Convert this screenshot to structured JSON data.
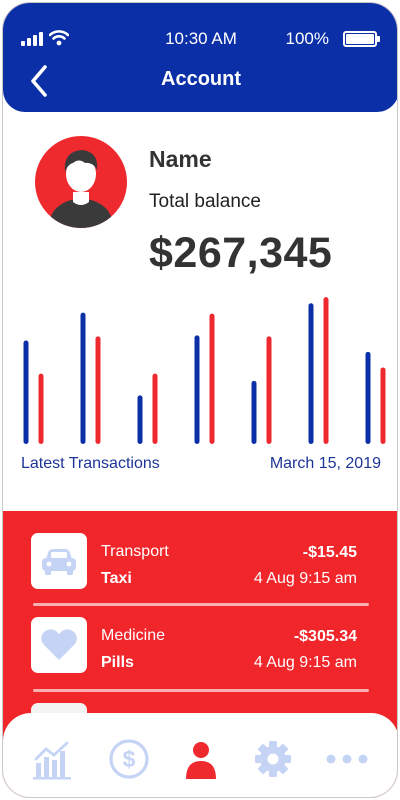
{
  "status_bar": {
    "time": "10:30 AM",
    "battery": "100%",
    "battery_level": 1.0
  },
  "header": {
    "title": "Account",
    "back_icon": "chevron-left-icon"
  },
  "profile": {
    "name": "Name",
    "balance_label": "Total balance",
    "balance": "$267,345",
    "avatar_icon": "user-avatar-icon"
  },
  "chart_data": {
    "type": "bar",
    "series": [
      {
        "name": "",
        "color": "#0b2fa6",
        "values": [
          100,
          127,
          47,
          105,
          61,
          136,
          89
        ]
      },
      {
        "name": "",
        "color": "#ef2a2f",
        "values": [
          68,
          104,
          68,
          126,
          104,
          142,
          74
        ]
      }
    ],
    "ylim": [
      0,
      145
    ],
    "grid": false
  },
  "chart_footer": {
    "left": "Latest Transactions",
    "right": "March 15, 2019"
  },
  "colors": {
    "primary": "#0b2fa6",
    "accent": "#ef2a2f",
    "nav_inactive": "#c5d3f5"
  },
  "transactions": [
    {
      "category": "Transport",
      "item": "Taxi",
      "amount": "-$15.45",
      "when": "4 Aug  9:15 am",
      "icon": "car-icon"
    },
    {
      "category": "Medicine",
      "item": "Pills",
      "amount": "-$305.34",
      "when": "4 Aug  9:15 am",
      "icon": "heart-icon"
    }
  ],
  "nav": [
    {
      "icon": "chart-icon",
      "active": false
    },
    {
      "icon": "dollar-icon",
      "active": false
    },
    {
      "icon": "user-icon",
      "active": true
    },
    {
      "icon": "gear-icon",
      "active": false
    },
    {
      "icon": "more-icon",
      "active": false
    }
  ]
}
